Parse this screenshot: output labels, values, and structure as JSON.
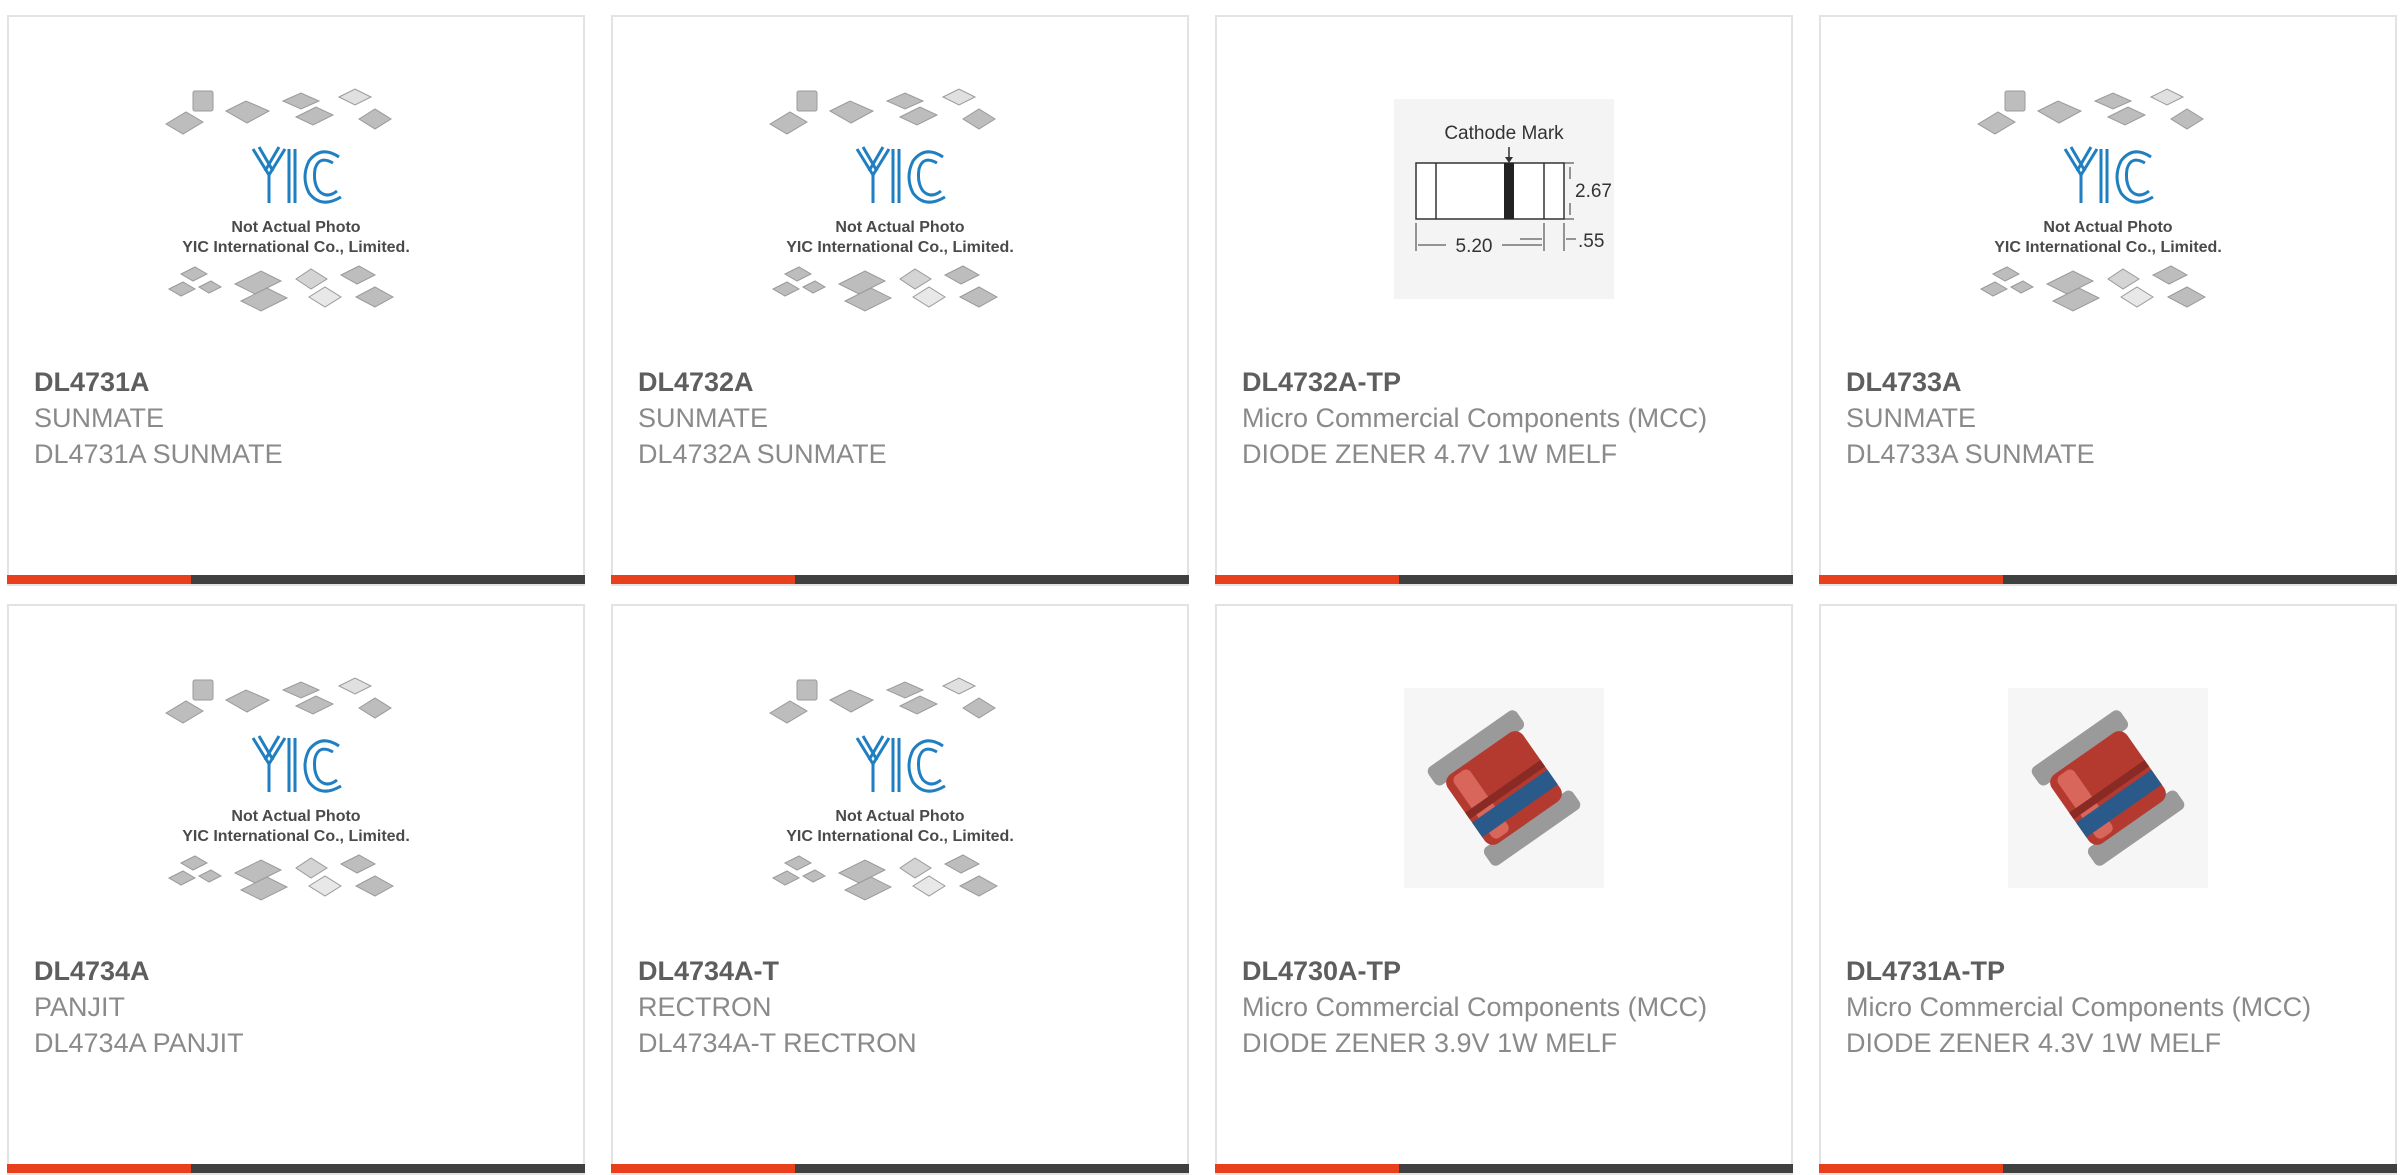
{
  "theme": {
    "accent": "#e8401c",
    "bar": "#404040"
  },
  "placeholder_image": {
    "brand": "YIC",
    "line1": "Not Actual Photo",
    "line2": "YIC International Co., Limited."
  },
  "drawing": {
    "cathode_label": "Cathode Mark",
    "dim_height": "2.67",
    "dim_length": "5.20",
    "dim_band": ".55"
  },
  "products": [
    {
      "part": "DL4731A",
      "manufacturer": "SUNMATE",
      "description": "DL4731A SUNMATE",
      "image": "yic-placeholder"
    },
    {
      "part": "DL4732A",
      "manufacturer": "SUNMATE",
      "description": "DL4732A SUNMATE",
      "image": "yic-placeholder"
    },
    {
      "part": "DL4732A-TP",
      "manufacturer": "Micro Commercial Components (MCC)",
      "description": "DIODE ZENER 4.7V 1W MELF",
      "image": "melf-drawing"
    },
    {
      "part": "DL4733A",
      "manufacturer": "SUNMATE",
      "description": "DL4733A SUNMATE",
      "image": "yic-placeholder"
    },
    {
      "part": "DL4734A",
      "manufacturer": "PANJIT",
      "description": "DL4734A PANJIT",
      "image": "yic-placeholder"
    },
    {
      "part": "DL4734A-T",
      "manufacturer": "RECTRON",
      "description": "DL4734A-T RECTRON",
      "image": "yic-placeholder"
    },
    {
      "part": "DL4730A-TP",
      "manufacturer": "Micro Commercial Components (MCC)",
      "description": "DIODE ZENER 3.9V 1W MELF",
      "image": "melf-photo"
    },
    {
      "part": "DL4731A-TP",
      "manufacturer": "Micro Commercial Components (MCC)",
      "description": "DIODE ZENER 4.3V 1W MELF",
      "image": "melf-photo"
    }
  ]
}
